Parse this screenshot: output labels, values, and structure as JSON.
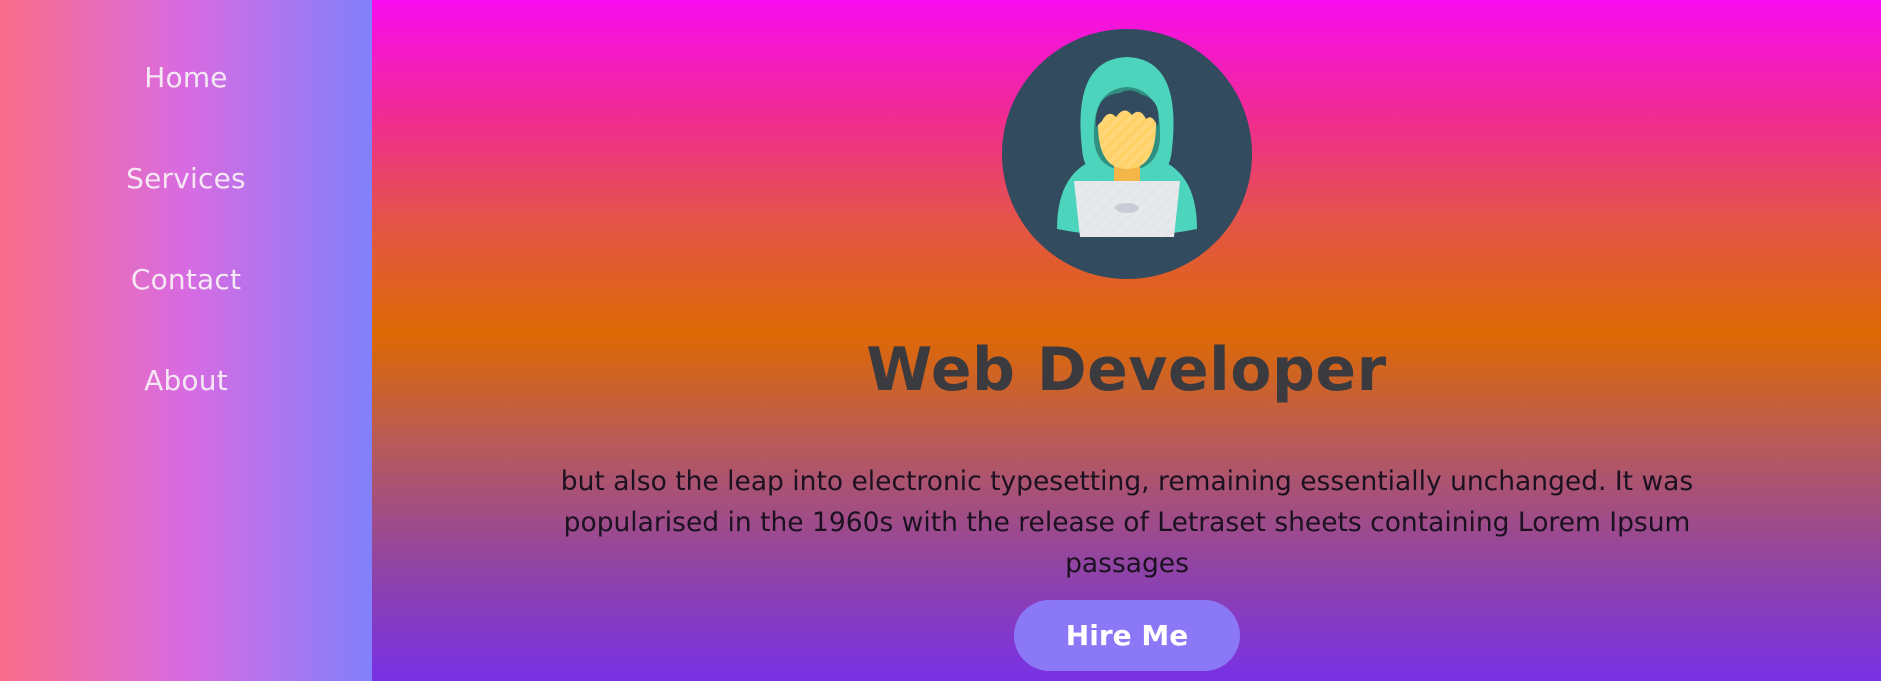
{
  "sidebar": {
    "items": [
      {
        "label": "Home"
      },
      {
        "label": "Services"
      },
      {
        "label": "Contact"
      },
      {
        "label": "About"
      }
    ]
  },
  "hero": {
    "avatar_icon": "developer-with-laptop-icon",
    "title": "Web Developer",
    "description": "but also the leap into electronic typesetting, remaining essentially unchanged. It was popularised in the 1960s with the release of Letraset sheets containing Lorem Ipsum passages",
    "cta_label": "Hire Me"
  },
  "colors": {
    "sidebar_gradient": [
      "#fb6e8a",
      "#d86be2",
      "#8180fb"
    ],
    "main_gradient": [
      "#f80cf0",
      "#dd6904",
      "#7831e5"
    ],
    "button": "#8b78f6",
    "avatar_circle": "#324b5e",
    "hood": "#4dd4bd",
    "face": "#ffd167",
    "laptop": "#e4e6ea"
  }
}
